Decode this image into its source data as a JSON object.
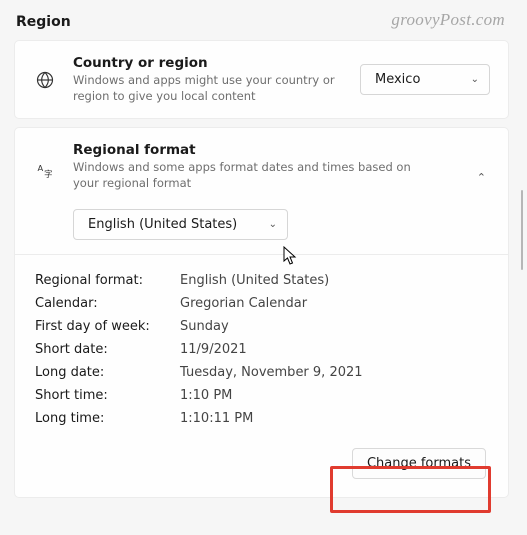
{
  "section_title": "Region",
  "watermark": "groovyPost.com",
  "country_card": {
    "title": "Country or region",
    "desc": "Windows and apps might use your country or region to give you local content",
    "selected": "Mexico"
  },
  "regional_card": {
    "title": "Regional format",
    "desc": "Windows and some apps format dates and times based on your regional format",
    "selected_language": "English (United States)",
    "details": [
      {
        "label": "Regional format:",
        "value": "English (United States)"
      },
      {
        "label": "Calendar:",
        "value": "Gregorian Calendar"
      },
      {
        "label": "First day of week:",
        "value": "Sunday"
      },
      {
        "label": "Short date:",
        "value": "11/9/2021"
      },
      {
        "label": "Long date:",
        "value": "Tuesday, November 9, 2021"
      },
      {
        "label": "Short time:",
        "value": "1:10 PM"
      },
      {
        "label": "Long time:",
        "value": "1:10:11 PM"
      }
    ],
    "change_button": "Change formats"
  }
}
